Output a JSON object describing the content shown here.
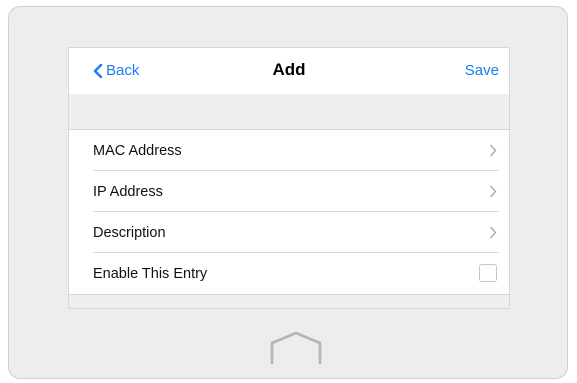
{
  "header": {
    "back_label": "Back",
    "title": "Add",
    "save_label": "Save"
  },
  "rows": {
    "mac": {
      "label": "MAC Address"
    },
    "ip": {
      "label": "IP Address"
    },
    "desc": {
      "label": "Description"
    },
    "enable": {
      "label": "Enable This Entry",
      "checked": false
    }
  },
  "icons": {
    "back": "chevron-left-icon",
    "row_arrow": "chevron-right-icon",
    "home": "home-icon"
  },
  "colors": {
    "accent": "#1a7cf5"
  }
}
